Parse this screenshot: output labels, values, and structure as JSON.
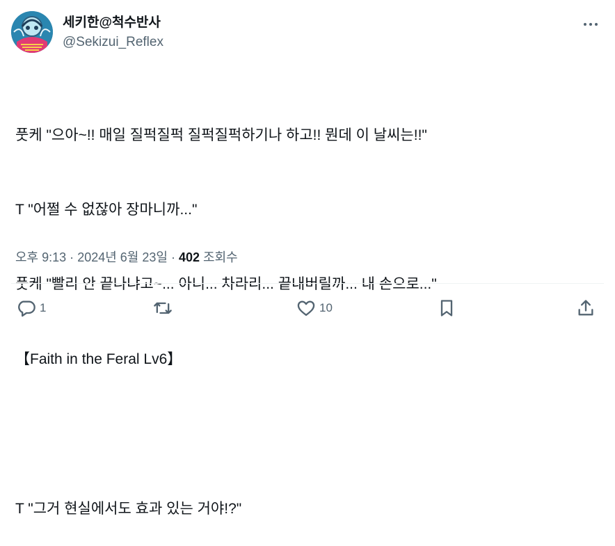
{
  "account": {
    "display_name": "세키한@척수반사",
    "handle": "@Sekizui_Reflex"
  },
  "post": {
    "lines": [
      "풋케 \"으아~!! 매일 질퍽질퍽 질퍽질퍽하기나 하고!! 뭔데 이 날씨는!!\"",
      "T \"어쩔 수 없잖아 장마니까...\"",
      "풋케 \"빨리 안 끝나냐고~... 아니... 차라리... 끝내버릴까... 내 손으로...\"",
      "【Faith in the Feral Lv6】",
      "",
      "T \"그거 현실에서도 효과 있는 거야!?\""
    ]
  },
  "meta": {
    "time": "오후 9:13",
    "date": "2024년 6월 23일",
    "views_count": "402",
    "views_label": "조회수",
    "separator": "·"
  },
  "actions": {
    "reply_count": "1",
    "repost_count": "",
    "like_count": "10"
  },
  "icons": {
    "more": "more-icon",
    "reply": "reply-icon",
    "repost": "repost-icon",
    "like": "like-icon",
    "bookmark": "bookmark-icon",
    "share": "share-icon"
  }
}
